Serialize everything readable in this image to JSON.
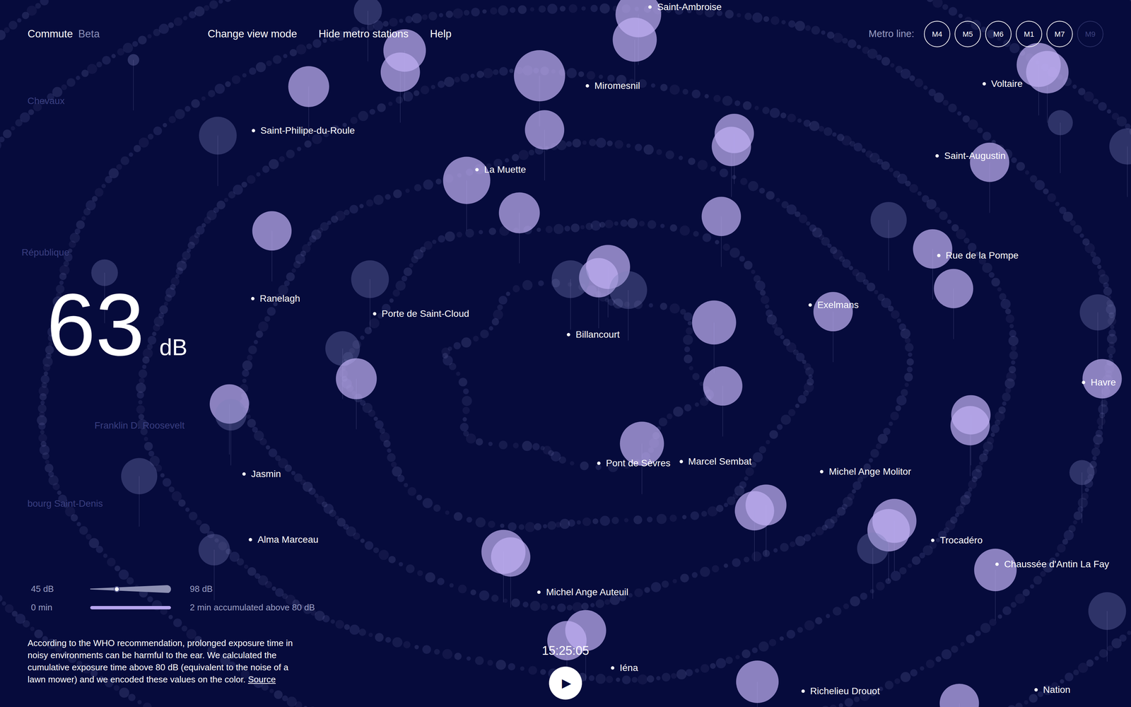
{
  "app": {
    "title": "Commute",
    "badge": "Beta"
  },
  "nav": [
    {
      "label": "Change view mode"
    },
    {
      "label": "Hide metro stations"
    },
    {
      "label": "Help"
    }
  ],
  "metro_lines": {
    "label": "Metro line:",
    "lines": [
      {
        "label": "M4",
        "active": true
      },
      {
        "label": "M5",
        "active": true
      },
      {
        "label": "M6",
        "active": true
      },
      {
        "label": "M1",
        "active": true
      },
      {
        "label": "M7",
        "active": true
      },
      {
        "label": "M9",
        "active": false
      }
    ]
  },
  "reading": {
    "value": "63",
    "unit": "dB"
  },
  "noise_scale": {
    "min": "45 dB",
    "max": "98 dB",
    "level": 0.33
  },
  "exposure": {
    "min": "0 min",
    "reading": "2 min accumulated above 80 dB",
    "level": 1
  },
  "note": {
    "text": "According to the WHO recommendation, prolonged exposure time in noisy environments can be harmful to the ear. We calculated the cumulative exposure time above 80 dB (equivalent to the noise of a lawn mower) and we encoded these values on the color.",
    "link": "Source"
  },
  "player": {
    "time": "15:25:05",
    "button": "▶",
    "playing": false
  },
  "stations": [
    {
      "name": "Saint-Ambroise",
      "faded": false
    },
    {
      "name": "Miromesnil",
      "faded": false
    },
    {
      "name": "Voltaire",
      "faded": false
    },
    {
      "name": "Saint-Philipe-du-Roule",
      "faded": false
    },
    {
      "name": "Saint-Augustin",
      "faded": false
    },
    {
      "name": "La Muette",
      "faded": false
    },
    {
      "name": "Rue de la Pompe",
      "faded": false
    },
    {
      "name": "Ranelagh",
      "faded": false
    },
    {
      "name": "Porte de Saint-Cloud",
      "faded": false
    },
    {
      "name": "Exelmans",
      "faded": false
    },
    {
      "name": "Billancourt",
      "faded": false
    },
    {
      "name": "Havre",
      "faded": false
    },
    {
      "name": "Pont de Sèvres",
      "faded": false
    },
    {
      "name": "Marcel Sembat",
      "faded": false
    },
    {
      "name": "Michel Ange Molitor",
      "faded": false
    },
    {
      "name": "Jasmin",
      "faded": false
    },
    {
      "name": "Trocadéro",
      "faded": false
    },
    {
      "name": "Chaussée d'Antin La Fay",
      "faded": false
    },
    {
      "name": "Michel Ange Auteuil",
      "faded": false
    },
    {
      "name": "Alma Marceau",
      "faded": false
    },
    {
      "name": "Iéna",
      "faded": false
    },
    {
      "name": "Nation",
      "faded": false
    },
    {
      "name": "Richelieu Drouot",
      "faded": false
    },
    {
      "name": "Chevaux",
      "faded": true
    },
    {
      "name": "République",
      "faded": true
    },
    {
      "name": "Franklin D. Roosevelt",
      "faded": true
    },
    {
      "name": "bourg Saint-Denis",
      "faded": true
    }
  ],
  "noise_readings_db": [
    95,
    88,
    86,
    84,
    80,
    82,
    78,
    80,
    90,
    82,
    80,
    78,
    80,
    80,
    80,
    76,
    86,
    80,
    78,
    78,
    86,
    80,
    80,
    80,
    80,
    80,
    86,
    84,
    76,
    80,
    80,
    80,
    86,
    82,
    80,
    86,
    84,
    86,
    80,
    82,
    80,
    84,
    84,
    78,
    80,
    74,
    82,
    80,
    70,
    76,
    70,
    64,
    45,
    76,
    70,
    66,
    62,
    62
  ]
}
